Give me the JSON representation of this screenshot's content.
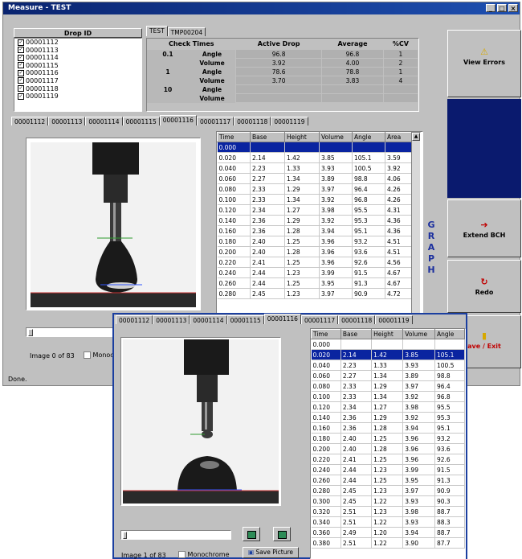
{
  "window": {
    "title": "Measure - TEST",
    "status": "Done."
  },
  "drop_id": {
    "header": "Drop ID",
    "items": [
      "00001112",
      "00001113",
      "00001114",
      "00001115",
      "00001116",
      "00001117",
      "00001118",
      "00001119"
    ]
  },
  "top_tabs": [
    "TEST",
    "TMP00204"
  ],
  "check_times": {
    "headers": [
      "Check Times",
      "Active Drop",
      "Average",
      "%CV"
    ],
    "rows": [
      {
        "time": "0.1",
        "kind": "Angle",
        "active": "96.8",
        "avg": "96.8",
        "cv": "1"
      },
      {
        "time": "",
        "kind": "Volume",
        "active": "3.92",
        "avg": "4.00",
        "cv": "2"
      },
      {
        "time": "1",
        "kind": "Angle",
        "active": "78.6",
        "avg": "78.8",
        "cv": "1"
      },
      {
        "time": "",
        "kind": "Volume",
        "active": "3.70",
        "avg": "3.83",
        "cv": "4"
      },
      {
        "time": "10",
        "kind": "Angle",
        "active": "",
        "avg": "",
        "cv": ""
      },
      {
        "time": "",
        "kind": "Volume",
        "active": "",
        "avg": "",
        "cv": ""
      }
    ]
  },
  "right_buttons": {
    "view_errors": "View Errors",
    "extend_bch": "Extend BCH",
    "redo": "Redo",
    "save_exit": "ave / Exit"
  },
  "drop_tabs": [
    "00001112",
    "00001113",
    "00001114",
    "00001115",
    "00001116",
    "00001117",
    "00001118",
    "00001119"
  ],
  "graph_label": [
    "G",
    "R",
    "A",
    "P",
    "H"
  ],
  "main_grid": {
    "headers": [
      "Time",
      "Base",
      "Height",
      "Volume",
      "Angle",
      "Area"
    ],
    "rows": [
      [
        "0.000",
        "",
        "",
        "",
        "",
        ""
      ],
      [
        "0.020",
        "2.14",
        "1.42",
        "3.85",
        "105.1",
        "3.59"
      ],
      [
        "0.040",
        "2.23",
        "1.33",
        "3.93",
        "100.5",
        "3.92"
      ],
      [
        "0.060",
        "2.27",
        "1.34",
        "3.89",
        "98.8",
        "4.06"
      ],
      [
        "0.080",
        "2.33",
        "1.29",
        "3.97",
        "96.4",
        "4.26"
      ],
      [
        "0.100",
        "2.33",
        "1.34",
        "3.92",
        "96.8",
        "4.26"
      ],
      [
        "0.120",
        "2.34",
        "1.27",
        "3.98",
        "95.5",
        "4.31"
      ],
      [
        "0.140",
        "2.36",
        "1.29",
        "3.92",
        "95.3",
        "4.36"
      ],
      [
        "0.160",
        "2.36",
        "1.28",
        "3.94",
        "95.1",
        "4.36"
      ],
      [
        "0.180",
        "2.40",
        "1.25",
        "3.96",
        "93.2",
        "4.51"
      ],
      [
        "0.200",
        "2.40",
        "1.28",
        "3.96",
        "93.6",
        "4.51"
      ],
      [
        "0.220",
        "2.41",
        "1.25",
        "3.96",
        "92.6",
        "4.56"
      ],
      [
        "0.240",
        "2.44",
        "1.23",
        "3.99",
        "91.5",
        "4.67"
      ],
      [
        "0.260",
        "2.44",
        "1.25",
        "3.95",
        "91.3",
        "4.67"
      ],
      [
        "0.280",
        "2.45",
        "1.23",
        "3.97",
        "90.9",
        "4.72"
      ]
    ]
  },
  "main_image": {
    "label": "Image 0 of 83",
    "monochrome": "Monochrome"
  },
  "overlay": {
    "tabs": [
      "00001112",
      "00001113",
      "00001114",
      "00001115",
      "00001116",
      "00001117",
      "00001118",
      "00001119"
    ],
    "grid_headers": [
      "Time",
      "Base",
      "Height",
      "Volume",
      "Angle"
    ],
    "rows": [
      [
        "0.000",
        "",
        "",
        "",
        ""
      ],
      [
        "0.020",
        "2.14",
        "1.42",
        "3.85",
        "105.1"
      ],
      [
        "0.040",
        "2.23",
        "1.33",
        "3.93",
        "100.5"
      ],
      [
        "0.060",
        "2.27",
        "1.34",
        "3.89",
        "98.8"
      ],
      [
        "0.080",
        "2.33",
        "1.29",
        "3.97",
        "96.4"
      ],
      [
        "0.100",
        "2.33",
        "1.34",
        "3.92",
        "96.8"
      ],
      [
        "0.120",
        "2.34",
        "1.27",
        "3.98",
        "95.5"
      ],
      [
        "0.140",
        "2.36",
        "1.29",
        "3.92",
        "95.3"
      ],
      [
        "0.160",
        "2.36",
        "1.28",
        "3.94",
        "95.1"
      ],
      [
        "0.180",
        "2.40",
        "1.25",
        "3.96",
        "93.2"
      ],
      [
        "0.200",
        "2.40",
        "1.28",
        "3.96",
        "93.6"
      ],
      [
        "0.220",
        "2.41",
        "1.25",
        "3.96",
        "92.6"
      ],
      [
        "0.240",
        "2.44",
        "1.23",
        "3.99",
        "91.5"
      ],
      [
        "0.260",
        "2.44",
        "1.25",
        "3.95",
        "91.3"
      ],
      [
        "0.280",
        "2.45",
        "1.23",
        "3.97",
        "90.9"
      ],
      [
        "0.300",
        "2.45",
        "1.22",
        "3.93",
        "90.3"
      ],
      [
        "0.320",
        "2.51",
        "1.23",
        "3.98",
        "88.7"
      ],
      [
        "0.340",
        "2.51",
        "1.22",
        "3.93",
        "88.3"
      ],
      [
        "0.360",
        "2.49",
        "1.20",
        "3.94",
        "88.7"
      ],
      [
        "0.380",
        "2.51",
        "1.22",
        "3.90",
        "87.7"
      ]
    ],
    "image_label": "Image 1 of 83",
    "monochrome": "Monochrome",
    "save_picture": "Save Picture"
  }
}
